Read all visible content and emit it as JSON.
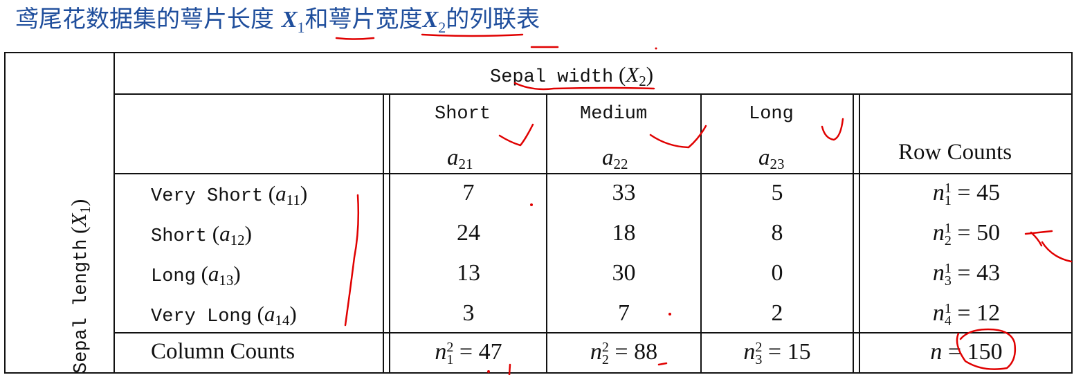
{
  "title": {
    "prefix": "鸢尾花数据集的萼片长度 ",
    "x1": "X",
    "x1_sub": "1",
    "middle": "和萼片宽度",
    "x2": "X",
    "x2_sub": "2",
    "suffix": "的列联表"
  },
  "table": {
    "col_group_label": "Sepal width",
    "col_group_var": "X",
    "col_group_var_sub": "2",
    "row_group_label": "Sepal length",
    "row_group_var": "X",
    "row_group_var_sub": "1",
    "columns": [
      {
        "name": "Short",
        "code": "a",
        "code_sub": "21"
      },
      {
        "name": "Medium",
        "code": "a",
        "code_sub": "22"
      },
      {
        "name": "Long",
        "code": "a",
        "code_sub": "23"
      }
    ],
    "row_counts_header": "Row Counts",
    "rows": [
      {
        "name": "Very Short",
        "code": "a",
        "code_sub": "11",
        "values": [
          "7",
          "33",
          "5"
        ],
        "count_sub": "1",
        "count_sup": "1",
        "count": "45"
      },
      {
        "name": "Short",
        "code": "a",
        "code_sub": "12",
        "values": [
          "24",
          "18",
          "8"
        ],
        "count_sub": "2",
        "count_sup": "1",
        "count": "50"
      },
      {
        "name": "Long",
        "code": "a",
        "code_sub": "13",
        "values": [
          "13",
          "30",
          "0"
        ],
        "count_sub": "3",
        "count_sup": "1",
        "count": "43"
      },
      {
        "name": "Very Long",
        "code": "a",
        "code_sub": "14",
        "values": [
          "3",
          "7",
          "2"
        ],
        "count_sub": "4",
        "count_sup": "1",
        "count": "12"
      }
    ],
    "column_counts_label": "Column Counts",
    "column_counts": [
      {
        "sub": "1",
        "sup": "2",
        "value": "47"
      },
      {
        "sub": "2",
        "sup": "2",
        "value": "88"
      },
      {
        "sub": "3",
        "sup": "2",
        "value": "15"
      }
    ],
    "total_symbol": "n",
    "total": "150",
    "n_symbol": "n",
    "eq": "="
  },
  "ink_color": "#e00000"
}
